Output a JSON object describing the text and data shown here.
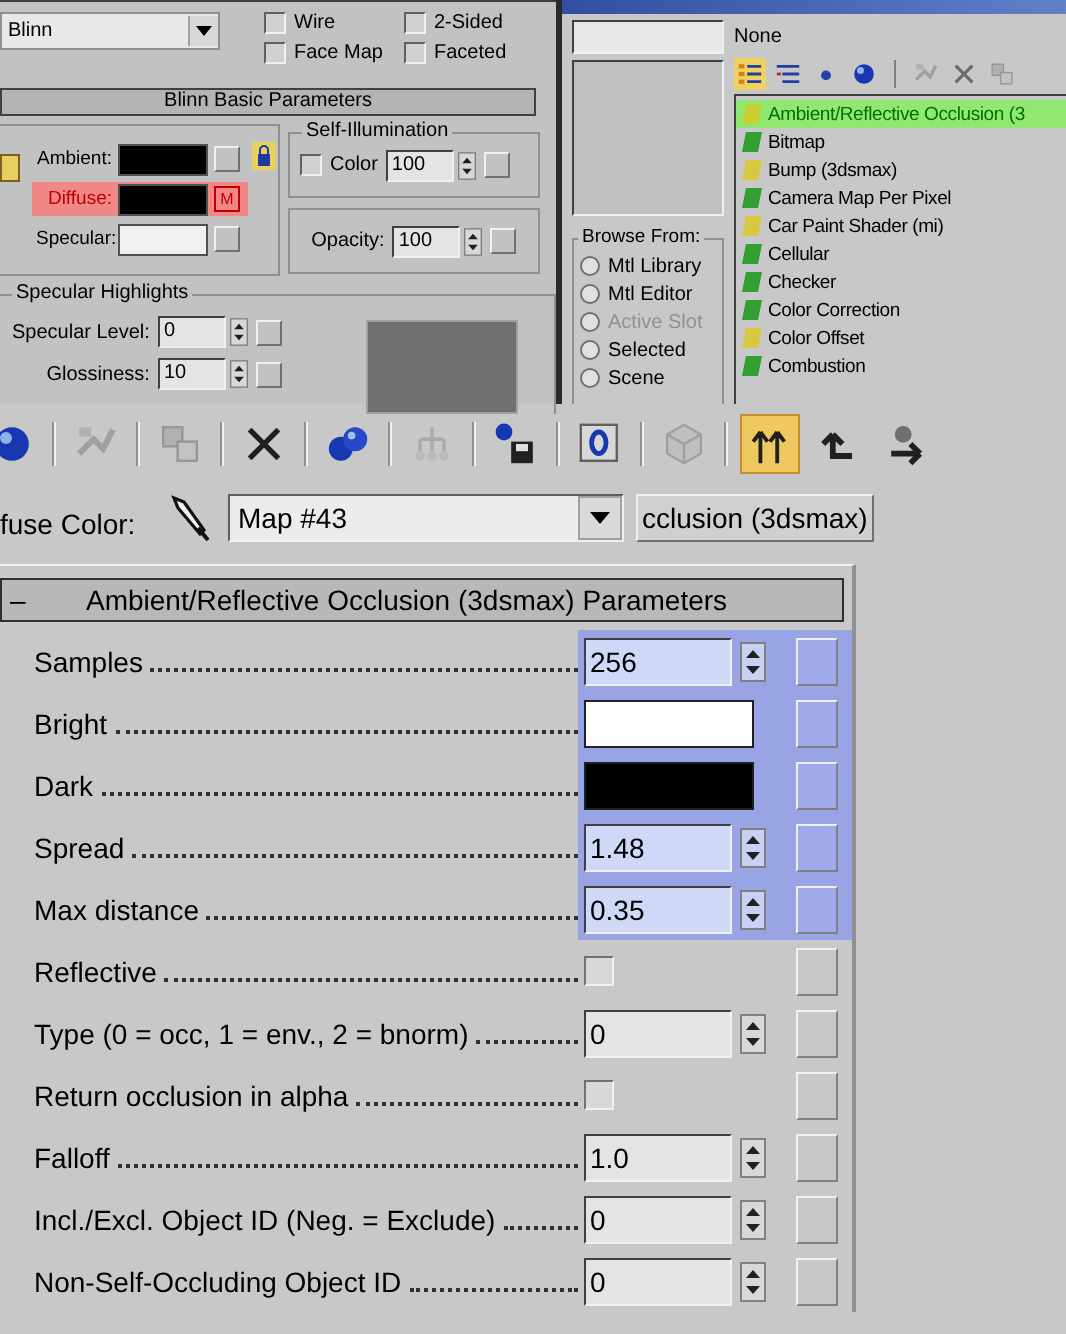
{
  "material_panel": {
    "shader": "Blinn",
    "options": [
      {
        "label": "Wire",
        "checked": false
      },
      {
        "label": "2-Sided",
        "checked": false
      },
      {
        "label": "Face Map",
        "checked": false
      },
      {
        "label": "Faceted",
        "checked": false
      }
    ],
    "basic_title": "Blinn Basic Parameters",
    "colors": [
      {
        "label": "Ambient:",
        "color": "#000000",
        "highlighted": false
      },
      {
        "label": "Diffuse:",
        "color": "#000000",
        "highlighted": true,
        "map_label": "M"
      },
      {
        "label": "Specular:",
        "color": "#f0f0f0",
        "highlighted": false
      }
    ],
    "self_illumination": {
      "title": "Self-Illumination",
      "label": "Color",
      "checked": false,
      "value": "100"
    },
    "opacity": {
      "label": "Opacity:",
      "value": "100"
    },
    "specular_highlights": {
      "title": "Specular Highlights",
      "params": [
        {
          "label": "Specular Level:",
          "value": "0"
        },
        {
          "label": "Glossiness:",
          "value": "10"
        }
      ]
    }
  },
  "map_browser": {
    "name": "None",
    "toolbar": [
      {
        "kind": "list-icons",
        "active": true,
        "disabled": false
      },
      {
        "kind": "list-text",
        "active": false,
        "disabled": false
      },
      {
        "kind": "small-sphere",
        "active": false,
        "disabled": false
      },
      {
        "kind": "large-sphere",
        "active": false,
        "disabled": false
      },
      {
        "kind": "assign",
        "active": false,
        "disabled": true
      },
      {
        "kind": "delete",
        "active": false,
        "disabled": true
      },
      {
        "kind": "copy",
        "active": false,
        "disabled": true
      }
    ],
    "browse_from": {
      "title": "Browse From:",
      "options": [
        {
          "label": "Mtl Library",
          "selected": false,
          "disabled": false
        },
        {
          "label": "Mtl Editor",
          "selected": false,
          "disabled": false
        },
        {
          "label": "Active Slot",
          "selected": false,
          "disabled": true
        },
        {
          "label": "Selected",
          "selected": false,
          "disabled": false
        },
        {
          "label": "Scene",
          "selected": false,
          "disabled": false
        }
      ]
    },
    "maps": [
      {
        "label": "Ambient/Reflective Occlusion (3",
        "color": "#c8d030",
        "selected": true
      },
      {
        "label": "Bitmap",
        "color": "#30a030",
        "selected": false
      },
      {
        "label": "Bump (3dsmax)",
        "color": "#d8c840",
        "selected": false
      },
      {
        "label": "Camera Map Per Pixel",
        "color": "#30a030",
        "selected": false
      },
      {
        "label": "Car Paint Shader (mi)",
        "color": "#d8c840",
        "selected": false
      },
      {
        "label": "Cellular",
        "color": "#30a030",
        "selected": false
      },
      {
        "label": "Checker",
        "color": "#30a030",
        "selected": false
      },
      {
        "label": "Color Correction",
        "color": "#30a030",
        "selected": false
      },
      {
        "label": "Color Offset",
        "color": "#d8c840",
        "selected": false
      },
      {
        "label": "Combustion",
        "color": "#30a030",
        "selected": false
      }
    ]
  },
  "toolbar": [
    {
      "kind": "sphere",
      "active": false,
      "disabled": false
    },
    {
      "kind": "assign",
      "active": false,
      "disabled": true
    },
    {
      "kind": "copy",
      "active": false,
      "disabled": true
    },
    {
      "kind": "delete",
      "active": false,
      "disabled": false
    },
    {
      "kind": "spheres",
      "active": false,
      "disabled": false
    },
    {
      "kind": "tree",
      "active": false,
      "disabled": true
    },
    {
      "kind": "save",
      "active": false,
      "disabled": false
    },
    {
      "kind": "zero",
      "active": false,
      "disabled": false
    },
    {
      "kind": "cube",
      "active": false,
      "disabled": true
    },
    {
      "kind": "show-end",
      "active": true,
      "disabled": false
    },
    {
      "kind": "parent",
      "active": false,
      "disabled": false
    },
    {
      "kind": "forward",
      "active": false,
      "disabled": false
    }
  ],
  "map_row": {
    "label": "fuse Color:",
    "map_name": "Map #43",
    "type_button": "cclusion (3dsmax)"
  },
  "rollout": {
    "collapse": "–",
    "title": "Ambient/Reflective Occlusion (3dsmax) Parameters",
    "params": [
      {
        "kind": "spinner",
        "label": "Samples",
        "value": "256",
        "highlighted": true
      },
      {
        "kind": "color",
        "label": "Bright",
        "color": "#ffffff",
        "highlighted": true
      },
      {
        "kind": "color",
        "label": "Dark",
        "color": "#000000",
        "highlighted": true
      },
      {
        "kind": "spinner",
        "label": "Spread",
        "value": "1.48",
        "highlighted": true
      },
      {
        "kind": "spinner",
        "label": "Max distance",
        "value": "0.35",
        "highlighted": true
      },
      {
        "kind": "checkbox",
        "label": "Reflective",
        "checked": false,
        "highlighted": false
      },
      {
        "kind": "spinner",
        "label": "Type (0 = occ, 1 = env., 2 = bnorm)",
        "value": "0",
        "highlighted": false
      },
      {
        "kind": "checkbox",
        "label": "Return occlusion in alpha",
        "checked": false,
        "highlighted": false
      },
      {
        "kind": "spinner",
        "label": "Falloff",
        "value": "1.0",
        "highlighted": false
      },
      {
        "kind": "spinner",
        "label": "Incl./Excl. Object ID (Neg. = Exclude)",
        "value": "0",
        "highlighted": false
      },
      {
        "kind": "spinner",
        "label": "Non-Self-Occluding Object ID",
        "value": "0",
        "highlighted": false
      }
    ]
  }
}
